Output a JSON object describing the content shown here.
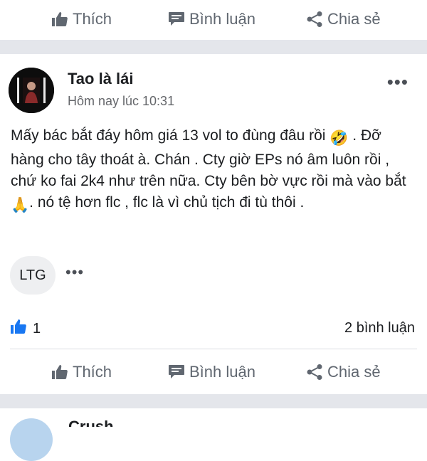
{
  "top_actions": {
    "like_label": "Thích",
    "comment_label": "Bình luận",
    "share_label": "Chia sẻ"
  },
  "post": {
    "author": "Tao là lái",
    "timestamp": "Hôm nay lúc 10:31",
    "body_1": "Mấy bác bắt đáy hôm giá 13 vol to đùng đâu rồi",
    "emoji_1": "🤣",
    "body_2": ". Đỡ hàng cho tây thoát à. Chán . Cty giờ EPs nó âm luôn rồi , chứ ko fai 2k4 như trên nữa. Cty bên bờ vực rồi mà vào bắt",
    "emoji_2": "🙏",
    "body_3": ". nó tệ hơn flc , flc là vì chủ tịch đi tù thôi .",
    "tag": "LTG",
    "more_options": "•••",
    "tag_more": "•••",
    "like_count": "1",
    "comment_count": "2 bình luận"
  },
  "bottom_actions": {
    "like_label": "Thích",
    "comment_label": "Bình luận",
    "share_label": "Chia sẻ"
  },
  "next_post": {
    "author_partial": "Crush"
  },
  "colors": {
    "separator": "#e4e6eb",
    "secondary_text": "#65676b",
    "action_text": "#606770",
    "like_blue": "#1877f2"
  }
}
